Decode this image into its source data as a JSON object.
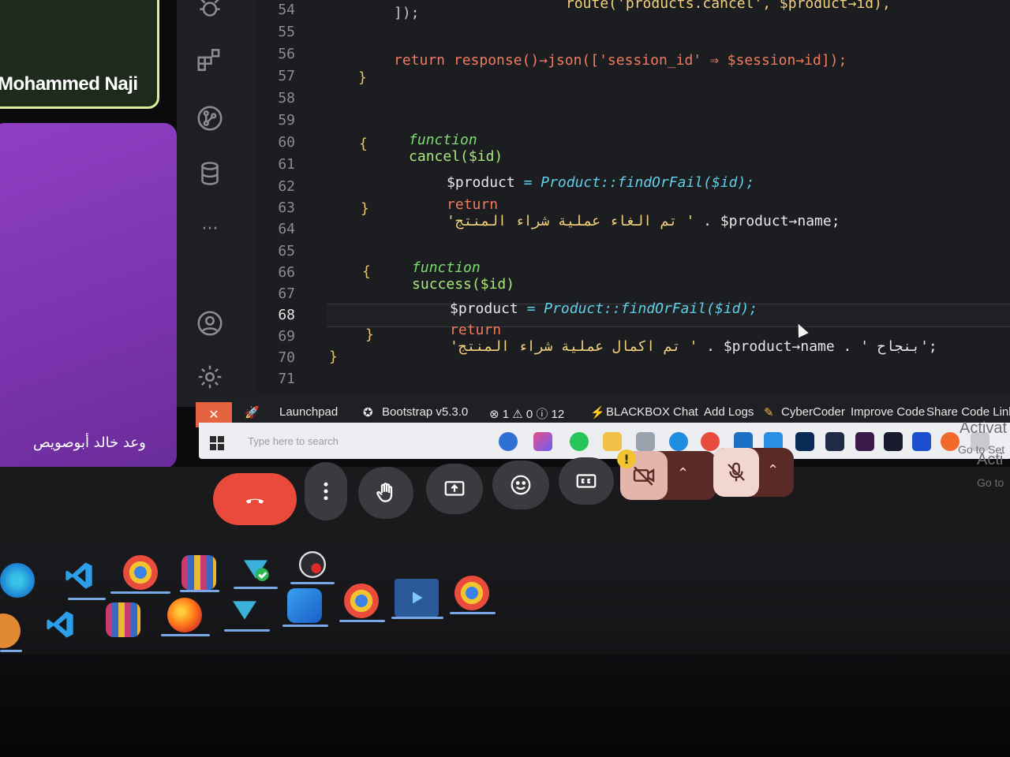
{
  "call": {
    "participant_top": "Mohammed Naji",
    "participant_purple": "وعد خالد أبوصويص"
  },
  "editor": {
    "line_numbers": [
      "54",
      "55",
      "56",
      "57",
      "58",
      "59",
      "60",
      "61",
      "62",
      "63",
      "64",
      "65",
      "66",
      "67",
      "68",
      "69",
      "70",
      "71"
    ],
    "active_line": "68",
    "code": {
      "l54a": "]);",
      "l54b": "route('products.cancel', $product→id),",
      "l56": "return response()→json(['session_id' ⇒ $session→id]);",
      "l57": "}",
      "l59_kw": "function",
      "l59_fn": "cancel($id)",
      "l60": "{",
      "l61_var": "$product",
      "l61_rest": " = Product::findOrFail($id);",
      "l62_kw": "return",
      "l62_str": "'تم الغاء عملية شراء المنتج '",
      "l62_rest": " . $product→name;",
      "l63": "}",
      "l65_kw": "function",
      "l65_fn": "success($id)",
      "l66": "{",
      "l67_var": "$product",
      "l67_rest": " = Product::findOrFail($id);",
      "l68_kw": "return",
      "l68_str": "'تم اكمال عملية شراء المنتج '",
      "l68_rest": " . $product→name . ' بنجاح';",
      "l69": "}",
      "l70": "}"
    }
  },
  "statusbar": {
    "launchpad": "Launchpad",
    "bootstrap": "Bootstrap v5.3.0",
    "problems": "⊗ 1 ⚠ 0 ⓘ 12",
    "blackbox": "BLACKBOX Chat",
    "add_logs": "Add Logs",
    "cybercoder": "CyberCoder",
    "improve": "Improve Code",
    "share": "Share Code Link"
  },
  "windows": {
    "search_placeholder": "Type here to search",
    "activate_1": "Activat",
    "activate_2": "Go to Set",
    "activate_3": "Acti",
    "activate_4": "Go to"
  },
  "colors": {
    "end_call": "#ea4a3b",
    "accent_purple": "#7a33ad",
    "name_border": "#d9ef9a"
  }
}
